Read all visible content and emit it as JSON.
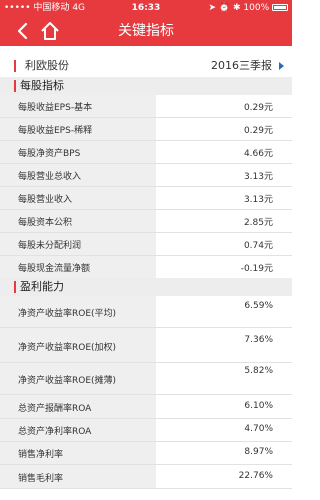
{
  "status_bar": {
    "carrier": "中国移动",
    "network": "4G",
    "time": "16:33",
    "battery": "100%",
    "icons": [
      "signal-dots-icon",
      "location-icon",
      "alarm-icon",
      "bluetooth-icon",
      "battery-icon"
    ]
  },
  "nav": {
    "title": "关键指标",
    "back_icon": "back-arrow-icon",
    "home_icon": "home-icon"
  },
  "company": {
    "name": "利欧股份",
    "period": "2016三季报",
    "dropdown_icon": "caret-right-icon"
  },
  "sections": [
    {
      "title": "每股指标",
      "rows": [
        {
          "label": "每股收益EPS-基本",
          "value": "0.29元"
        },
        {
          "label": "每股收益EPS-稀释",
          "value": "0.29元"
        },
        {
          "label": "每股净资产BPS",
          "value": "4.66元"
        },
        {
          "label": "每股营业总收入",
          "value": "3.13元"
        },
        {
          "label": "每股营业收入",
          "value": "3.13元"
        },
        {
          "label": "每股资本公积",
          "value": "2.85元"
        },
        {
          "label": "每股未分配利润",
          "value": "0.74元"
        },
        {
          "label": "每股现金流量净额",
          "value": "-0.19元"
        }
      ]
    },
    {
      "title": "盈利能力",
      "rows": [
        {
          "label": "净资产收益率ROE(平均)",
          "value": "6.59%"
        },
        {
          "label": "净资产收益率ROE(加权)",
          "value": "7.36%"
        },
        {
          "label": "净资产收益率ROE(摊薄)",
          "value": "5.82%"
        },
        {
          "label": "总资产报酬率ROA",
          "value": "6.10%"
        },
        {
          "label": "总资产净利率ROA",
          "value": "4.70%"
        },
        {
          "label": "销售净利率",
          "value": "8.97%"
        },
        {
          "label": "销售毛利率",
          "value": "22.76%"
        }
      ]
    }
  ],
  "colors": {
    "brand_red": "#e73a3f",
    "label_bg": "#efefef",
    "section_bg": "#ededed",
    "link_blue": "#2b6cb0"
  }
}
